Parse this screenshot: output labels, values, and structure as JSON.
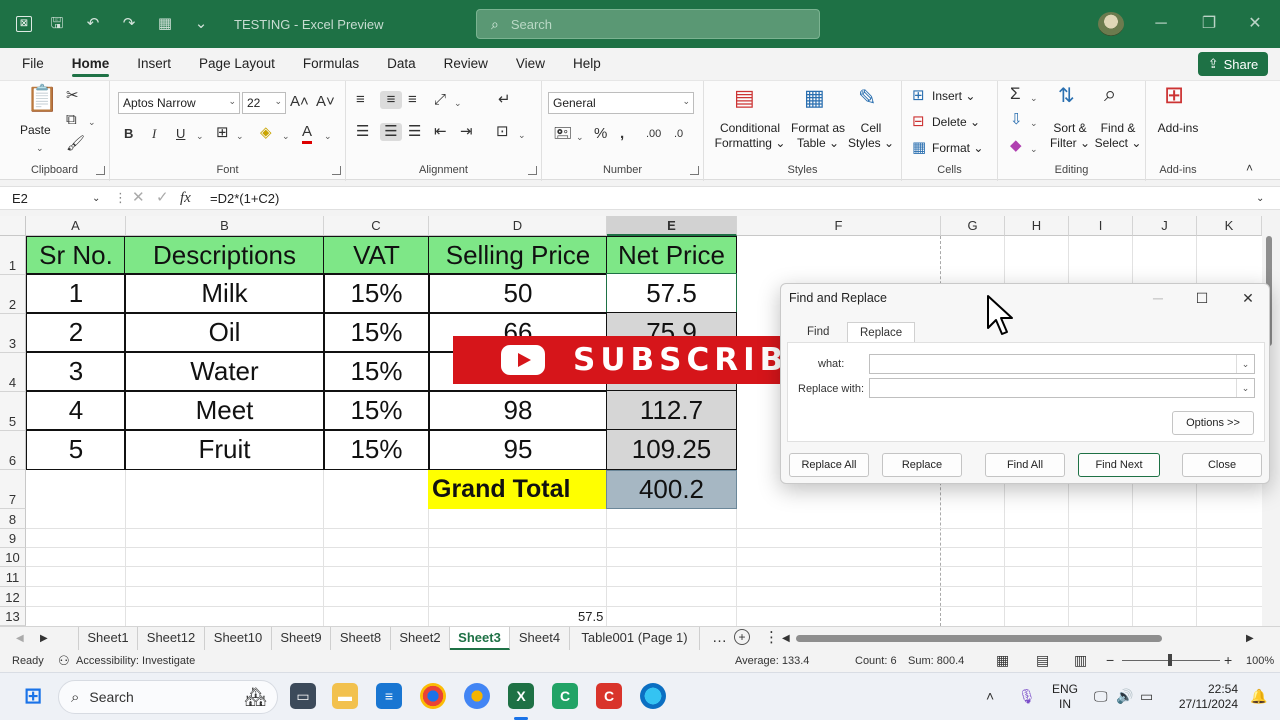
{
  "titlebar": {
    "doc_title": "TESTING  -  Excel Preview",
    "search_placeholder": "Search"
  },
  "menu": [
    "File",
    "Home",
    "Insert",
    "Page Layout",
    "Formulas",
    "Data",
    "Review",
    "View",
    "Help"
  ],
  "share_label": "Share",
  "ribbon": {
    "clipboard": {
      "paste": "Paste",
      "label": "Clipboard"
    },
    "font": {
      "name": "Aptos Narrow",
      "size": "22",
      "label": "Font"
    },
    "alignment": {
      "label": "Alignment"
    },
    "number": {
      "format": "General",
      "label": "Number"
    },
    "styles": {
      "conditional": [
        "Conditional",
        "Formatting"
      ],
      "format_table": [
        "Format as",
        "Table"
      ],
      "cell_styles": [
        "Cell",
        "Styles"
      ],
      "label": "Styles"
    },
    "cells": {
      "insert": "Insert",
      "delete": "Delete",
      "format": "Format",
      "label": "Cells"
    },
    "editing": {
      "sort": [
        "Sort &",
        "Filter"
      ],
      "find": [
        "Find &",
        "Select"
      ],
      "label": "Editing"
    },
    "addins": {
      "addins": "Add-ins",
      "label": "Add-ins"
    }
  },
  "formula_bar": {
    "name_box": "E2",
    "formula": "=D2*(1+C2)"
  },
  "columns": [
    "A",
    "B",
    "C",
    "D",
    "E",
    "F",
    "G",
    "H",
    "I",
    "J",
    "K"
  ],
  "rows": [
    "1",
    "2",
    "3",
    "4",
    "5",
    "6",
    "7",
    "8",
    "9",
    "10",
    "11",
    "12",
    "13"
  ],
  "table": {
    "headers": [
      "Sr No.",
      "Descriptions",
      "VAT",
      "Selling Price",
      "Net Price"
    ],
    "rows": [
      [
        "1",
        "Milk",
        "15%",
        "50",
        "57.5"
      ],
      [
        "2",
        "Oil",
        "15%",
        "66",
        "75.9"
      ],
      [
        "3",
        "Water",
        "15%",
        "",
        ""
      ],
      [
        "4",
        "Meet",
        "15%",
        "98",
        "112.7"
      ],
      [
        "5",
        "Fruit",
        "15%",
        "95",
        "109.25"
      ]
    ],
    "total_label": "Grand Total",
    "total_value": "400.2"
  },
  "stray_value": "57.5",
  "banner": {
    "text": "SUBSCRIBE"
  },
  "dialog": {
    "title": "Find and Replace",
    "tab_find": "Find",
    "tab_replace": "Replace",
    "find_what_label": "what:",
    "replace_with_label": "Replace with:",
    "options": "Options >>",
    "buttons": [
      "Replace All",
      "Replace",
      "Find All",
      "Find Next",
      "Close"
    ]
  },
  "sheets": [
    "Sheet1",
    "Sheet12",
    "Sheet10",
    "Sheet9",
    "Sheet8",
    "Sheet2",
    "Sheet3",
    "Sheet4",
    "Table001 (Page 1)"
  ],
  "active_sheet": "Sheet3",
  "status": {
    "ready": "Ready",
    "accessibility": "Accessibility: Investigate",
    "average": "Average: 133.4",
    "count": "Count: 6",
    "sum": "Sum: 800.4",
    "zoom": "100%"
  },
  "taskbar": {
    "search": "Search",
    "lang": [
      "ENG",
      "IN"
    ],
    "time": "22:54",
    "date": "27/11/2024"
  },
  "colors": {
    "excel_green": "#1e7145",
    "header_fill": "#7ee787",
    "total_yellow": "#ffff00",
    "banner_red": "#d6151a"
  }
}
